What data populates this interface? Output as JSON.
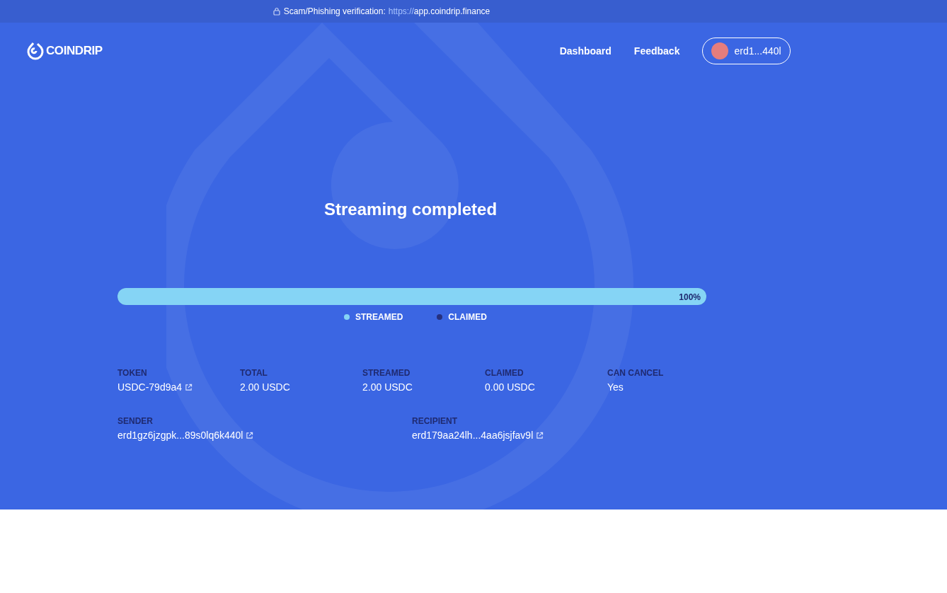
{
  "banner": {
    "label": "Scam/Phishing verification:",
    "protocol": "https://",
    "domain": "app.coindrip.finance"
  },
  "brand": {
    "name": "COINDRIP"
  },
  "nav": [
    {
      "label": "Dashboard"
    },
    {
      "label": "Feedback"
    }
  ],
  "wallet": {
    "address": "erd1...440l"
  },
  "title": "Streaming completed",
  "progress": {
    "level": 1,
    "reading": "100%"
  },
  "legend": [
    {
      "label": "STREAMED",
      "color": "#85d4f5"
    },
    {
      "label": "CLAIMED",
      "color": "#26307f"
    }
  ],
  "stats": [
    {
      "label": "TOKEN",
      "value": "USDC-79d9a4",
      "kind": "link"
    },
    {
      "label": "TOTAL",
      "value": "2.00 USDC",
      "kind": "text"
    },
    {
      "label": "STREAMED",
      "value": "2.00 USDC",
      "kind": "text"
    },
    {
      "label": "CLAIMED",
      "value": "0.00 USDC",
      "kind": "text"
    },
    {
      "label": "CAN CANCEL",
      "value": "Yes",
      "kind": "text"
    }
  ],
  "parties": [
    {
      "label": "SENDER",
      "value": "erd1gz6jzgpk...89s0lq6k440l",
      "kind": "link"
    },
    {
      "label": "RECIPIENT",
      "value": "erd179aa24lh...4aa6jsjfav9l",
      "kind": "link"
    }
  ]
}
